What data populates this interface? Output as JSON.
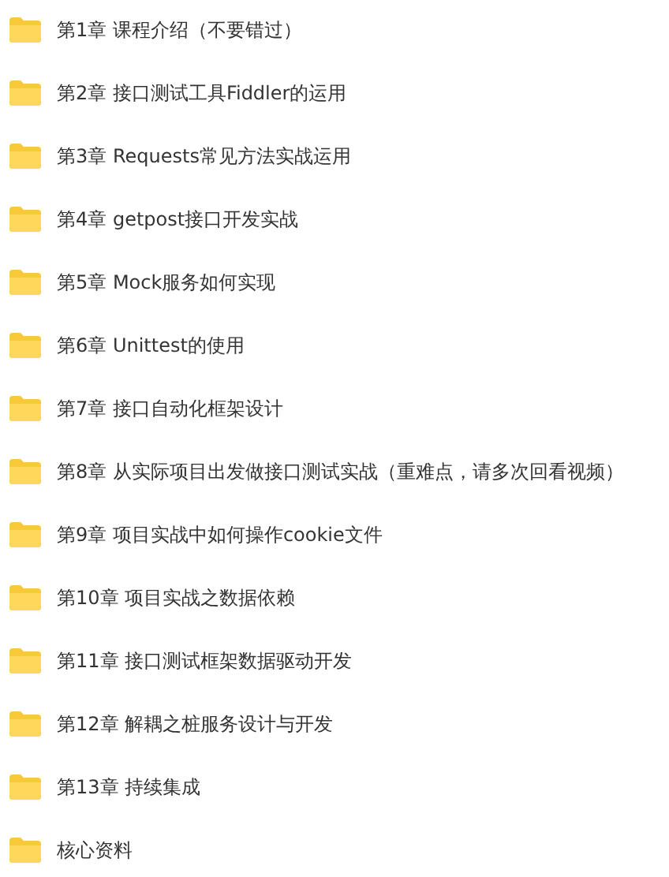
{
  "folders": [
    {
      "name": "第1章 课程介绍（不要错过）"
    },
    {
      "name": "第2章 接口测试工具Fiddler的运用"
    },
    {
      "name": "第3章 Requests常见方法实战运用"
    },
    {
      "name": "第4章 getpost接口开发实战"
    },
    {
      "name": "第5章 Mock服务如何实现"
    },
    {
      "name": "第6章 Unittest的使用"
    },
    {
      "name": "第7章 接口自动化框架设计"
    },
    {
      "name": "第8章 从实际项目出发做接口测试实战（重难点，请多次回看视频）"
    },
    {
      "name": "第9章 项目实战中如何操作cookie文件"
    },
    {
      "name": "第10章 项目实战之数据依赖"
    },
    {
      "name": "第11章 接口测试框架数据驱动开发"
    },
    {
      "name": "第12章 解耦之桩服务设计与开发"
    },
    {
      "name": "第13章 持续集成"
    },
    {
      "name": "核心资料"
    }
  ]
}
